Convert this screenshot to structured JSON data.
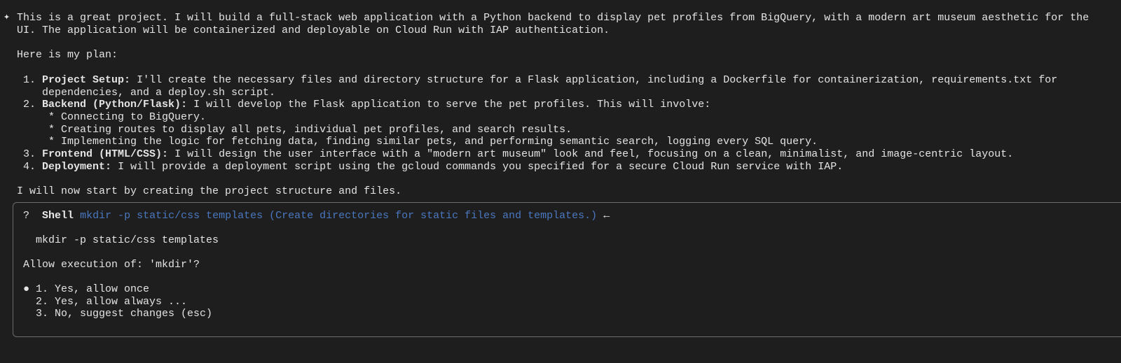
{
  "response": {
    "intro_line1": "This is a great project. I will build a full-stack web application with a Python backend to display pet profiles from BigQuery, with a modern art museum aesthetic for the",
    "intro_line2": "UI. The application will be containerized and deployable on Cloud Run with IAP authentication.",
    "plan_heading": "Here is my plan:",
    "plan": [
      {
        "number": "1.",
        "title": "Project Setup:",
        "text1": " I'll create the necessary files and directory structure for a Flask application, including a Dockerfile for containerization, requirements.txt for",
        "text2": "dependencies, and a deploy.sh script."
      },
      {
        "number": "2.",
        "title": "Backend (Python/Flask):",
        "text1": " I will develop the Flask application to serve the pet profiles. This will involve:",
        "bullets": [
          "* Connecting to BigQuery.",
          "* Creating routes to display all pets, individual pet profiles, and search results.",
          "* Implementing the logic for fetching data, finding similar pets, and performing semantic search, logging every SQL query."
        ]
      },
      {
        "number": "3.",
        "title": "Frontend (HTML/CSS):",
        "text1": " I will design the user interface with a \"modern art museum\" look and feel, focusing on a clean, minimalist, and image-centric layout."
      },
      {
        "number": "4.",
        "title": "Deployment:",
        "text1": " I will provide a deployment script using the gcloud commands you specified for a secure Cloud Run service with IAP."
      }
    ],
    "closing": "I will now start by creating the project structure and files."
  },
  "prompt_box": {
    "status_icon": "?",
    "tool_name": "Shell",
    "command_description": "mkdir -p static/css templates (Create directories for static files and templates.)",
    "arrow": "←",
    "command": "mkdir -p static/css templates",
    "question": "Allow execution of: 'mkdir'?",
    "options": [
      {
        "marker": "●",
        "label": "1. Yes, allow once"
      },
      {
        "marker": "",
        "label": "2. Yes, allow always ..."
      },
      {
        "marker": "",
        "label": "3. No, suggest changes (esc)"
      }
    ]
  },
  "icons": {
    "assistant": "sparkle-icon"
  },
  "colors": {
    "background": "#1e1e1e",
    "text": "#e4e4e4",
    "command_blue": "#4a78c0",
    "border": "#6a6a6a"
  }
}
